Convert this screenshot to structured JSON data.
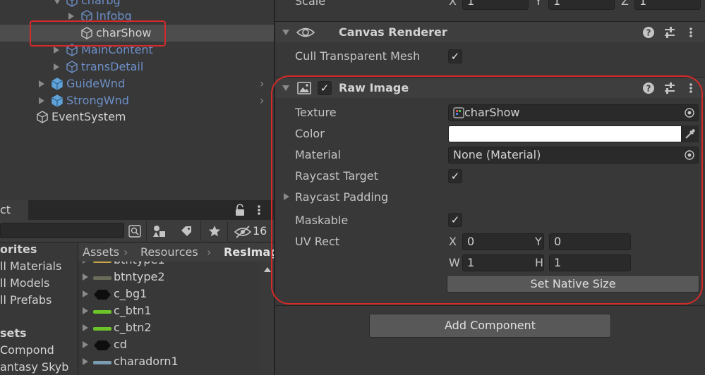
{
  "hierarchy": {
    "items": [
      {
        "label": "charbg",
        "depth": 3,
        "style": "blue",
        "expanded": true
      },
      {
        "label": "Infobg",
        "depth": 4,
        "style": "blue",
        "expanded": false
      },
      {
        "label": "charShow",
        "depth": 4,
        "style": "selected"
      },
      {
        "label": "MainContent",
        "depth": 3,
        "style": "blue",
        "expanded": false
      },
      {
        "label": "transDetail",
        "depth": 3,
        "style": "blue",
        "expanded": false
      },
      {
        "label": "GuideWnd",
        "depth": 2,
        "style": "blue",
        "expanded": false,
        "prefab": true
      },
      {
        "label": "StrongWnd",
        "depth": 2,
        "style": "blue",
        "expanded": false,
        "prefab": true
      },
      {
        "label": "EventSystem",
        "depth": 1,
        "style": "normal"
      }
    ]
  },
  "project": {
    "tab_label": "ct",
    "search_placeholder": "",
    "hidden_count": "16",
    "favorites": [
      {
        "label": "orites",
        "header": true
      },
      {
        "label": "ll Materials"
      },
      {
        "label": "ll Models"
      },
      {
        "label": "ll Prefabs"
      },
      {
        "label": "sets",
        "header": true
      },
      {
        "label": "Compond"
      },
      {
        "label": "antasy Skyb"
      }
    ],
    "breadcrumb": [
      "Assets",
      "Resources",
      "ResImag"
    ],
    "files": [
      {
        "name": "btntype1",
        "thumb": "#c7a64a"
      },
      {
        "name": "btntype2",
        "thumb": "#6b6b5a"
      },
      {
        "name": "c_bg1",
        "thumb": "#111111"
      },
      {
        "name": "c_btn1",
        "thumb": "#6cc42a"
      },
      {
        "name": "c_btn2",
        "thumb": "#6cc42a"
      },
      {
        "name": "cd",
        "thumb": "#111111"
      },
      {
        "name": "charadorn1",
        "thumb": "#7a9bb0"
      }
    ]
  },
  "inspector": {
    "scale_label": "Scale",
    "scale_x": "1",
    "scale_y": "1",
    "scale_z": "1",
    "canvas_renderer": {
      "title": "Canvas Renderer",
      "cull_label": "Cull Transparent Mesh",
      "cull_checked": true
    },
    "raw_image": {
      "title": "Raw Image",
      "enabled": true,
      "texture_label": "Texture",
      "texture_value": "charShow",
      "color_label": "Color",
      "color_value": "#ffffff",
      "material_label": "Material",
      "material_value": "None (Material)",
      "raycast_target_label": "Raycast Target",
      "raycast_target_checked": true,
      "raycast_padding_label": "Raycast Padding",
      "maskable_label": "Maskable",
      "maskable_checked": true,
      "uv_rect_label": "UV Rect",
      "uv_x_label": "X",
      "uv_x": "0",
      "uv_y_label": "Y",
      "uv_y": "0",
      "uv_w_label": "W",
      "uv_w": "1",
      "uv_h_label": "H",
      "uv_h": "1",
      "set_native_size": "Set Native Size"
    },
    "add_component": "Add Component"
  }
}
